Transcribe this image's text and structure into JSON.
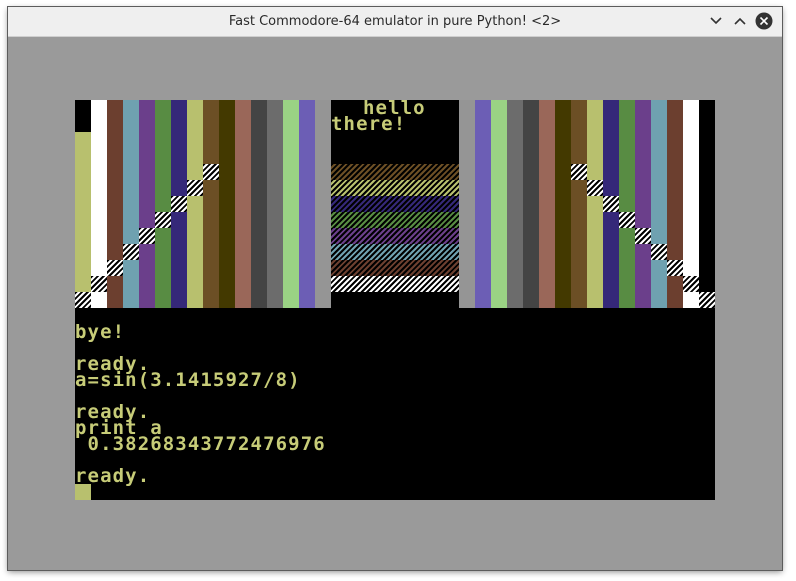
{
  "window": {
    "title": "Fast Commodore-64 emulator in pure Python! <2>"
  },
  "titlebar_icons": [
    "chevron-down-icon",
    "chevron-up-icon",
    "close-icon"
  ],
  "palette": {
    "black": "#000000",
    "white": "#ffffff",
    "brown": "#6c3f2f",
    "cyan": "#6fa1b0",
    "purple": "#6b3f8b",
    "green": "#588c43",
    "blue": "#352879",
    "yellow": "#b8c06e",
    "orange": "#6c4f25",
    "darkbrown": "#433900",
    "pink": "#9a6759",
    "darkgrey": "#444444",
    "grey": "#6c6c6c",
    "lightgreen": "#9ad284",
    "lightblue": "#6c5eb5",
    "lightgrey": "#959595"
  },
  "screen": {
    "banner_line1": "hello",
    "banner_line2": "there!",
    "lines": [
      "bye!",
      "",
      "ready.",
      "a=sin(3.1415927/8)",
      "",
      "ready.",
      "print a",
      " 0.38268343772476976",
      "",
      "ready."
    ],
    "text_color": "#c7cc78",
    "cursor_color": "#b8c06e"
  }
}
